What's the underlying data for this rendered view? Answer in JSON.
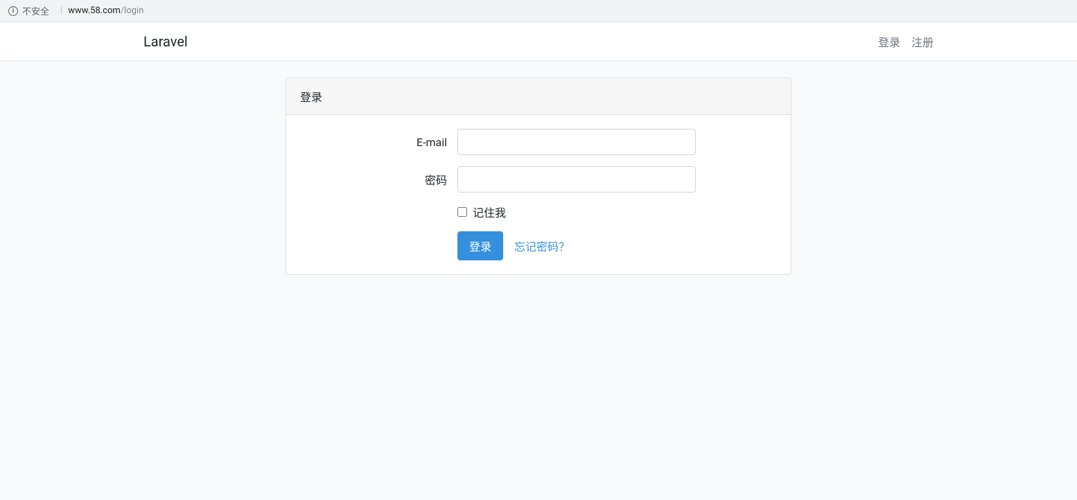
{
  "addressBar": {
    "securityText": "不安全",
    "urlDomain": "www.58.com",
    "urlPath": "/login"
  },
  "navbar": {
    "brand": "Laravel",
    "links": {
      "login": "登录",
      "register": "注册"
    }
  },
  "card": {
    "header": "登录",
    "emailLabel": "E-mail",
    "passwordLabel": "密码",
    "rememberLabel": "记住我",
    "submitLabel": "登录",
    "forgotLabel": "忘记密码？"
  }
}
